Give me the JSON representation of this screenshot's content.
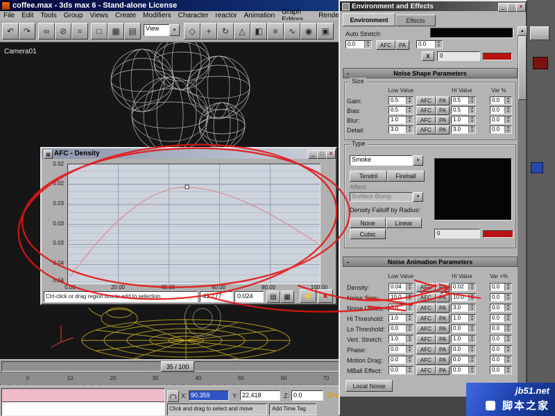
{
  "icons": {
    "min": "_",
    "max": "□",
    "close": "×",
    "up": "▲",
    "down": "▼",
    "minus": "-",
    "afc_window": "▦",
    "lightning": "⚡",
    "grid": "▤",
    "cells": "▦",
    "dropdown": "▼"
  },
  "main": {
    "title": "coffee.max - 3ds max 6 - Stand-alone License",
    "menus": [
      "File",
      "Edit",
      "Tools",
      "Group",
      "Views",
      "Create",
      "Modifiers",
      "Character",
      "reactor",
      "Animation",
      "Graph Editors",
      "Render"
    ],
    "toolbar": {
      "view_combo": "View",
      "icons": [
        {
          "name": "undo",
          "g": "↶"
        },
        {
          "name": "redo",
          "g": "↷"
        },
        {
          "name": "select-and-link",
          "g": "∞"
        },
        {
          "name": "unlink-selection",
          "g": "⊘"
        },
        {
          "name": "bind-to-spacewarp",
          "g": "≈"
        },
        {
          "name": "select-object",
          "g": "□"
        },
        {
          "name": "selection-region",
          "g": "▦"
        },
        {
          "name": "select-by-name",
          "g": "▤"
        },
        {
          "name": "crossing-selection",
          "g": "◇"
        },
        {
          "name": "select-and-move",
          "g": "+"
        },
        {
          "name": "select-and-rotate",
          "g": "↻"
        },
        {
          "name": "select-and-scale",
          "g": "△"
        },
        {
          "name": "mirror",
          "g": "◧"
        },
        {
          "name": "align",
          "g": "≡"
        },
        {
          "name": "curve-editor",
          "g": "∿"
        },
        {
          "name": "material-editor",
          "g": "◉"
        },
        {
          "name": "render-scene",
          "g": "▣"
        }
      ]
    },
    "viewport_label": "Camera01",
    "timeline": {
      "slider_label": "35 / 100",
      "ruler_ticks": [
        "0",
        "10",
        "20",
        "30",
        "40",
        "50",
        "60",
        "70"
      ]
    },
    "status": {
      "prompt": "Click and drag to select and move",
      "time_tag": "Add Time Tag",
      "x_label": "X:",
      "y_label": "Y:",
      "z_label": "Z:",
      "x_value": "90.359",
      "y_value": "22.418",
      "z_value": "0.0"
    }
  },
  "afc": {
    "title": "AFC - Density",
    "y_ticks": [
      "0.02",
      "0.02",
      "0.03",
      "0.03",
      "0.03",
      "0.04",
      "0.04"
    ],
    "x_ticks": [
      "0.00",
      "20.00",
      "40.00",
      "60.00",
      "80.00",
      "100.00"
    ],
    "status_text": "Ctrl-click or drag region box to add to selection.",
    "sel_x": "43.777",
    "sel_y": "0.024",
    "curve": {
      "frames": [
        0,
        20,
        43.777,
        60,
        80,
        100
      ],
      "density": [
        0.04,
        0.028,
        0.024,
        0.026,
        0.03,
        0.034
      ]
    }
  },
  "env": {
    "title": "Environment and Effects",
    "tabs": [
      "Environment",
      "Effects"
    ],
    "afc_label": "AFC",
    "pa_label": "PA",
    "auto_stretch": {
      "label": "Auto Stretch:",
      "low": "0.0",
      "hi": "0.0",
      "x_btn": "X",
      "x_val": "0"
    },
    "shape": {
      "header": "Noise Shape Parameters",
      "group": "Size",
      "col_low": "Low Value",
      "col_hi": "Hi Value",
      "col_var": "Var %",
      "rows": [
        {
          "label": "Gain:",
          "low": "0.5",
          "hi": "0.5",
          "var": "0.0"
        },
        {
          "label": "Bias:",
          "low": "0.5",
          "hi": "0.5",
          "var": "0.0"
        },
        {
          "label": "Blur:",
          "low": "1.0",
          "hi": "1.0",
          "var": "0.0"
        },
        {
          "label": "Detail:",
          "low": "3.0",
          "hi": "3.0",
          "var": "0.0"
        }
      ]
    },
    "type": {
      "label": "Type",
      "selected": "Smoke",
      "tendril": "Tendril",
      "fireball": "Fireball",
      "affect_label": "Affect:",
      "affect_selected": "Surface Bump",
      "falloff_label": "Density Falloff by Radius:",
      "none": "None",
      "linear": "Linear",
      "cubic": "Cubic",
      "value": "0"
    },
    "anim": {
      "header": "Noise Animation Parameters",
      "col_low": "Low Value",
      "col_hi": "Hi Value",
      "col_var": "Var +%",
      "rows": [
        {
          "label": "Density:",
          "low": "0.04",
          "hi": "0.02",
          "var": "0.0"
        },
        {
          "label": "Noise Size:",
          "low": "10.0",
          "hi": "10.0",
          "var": "0.0"
        },
        {
          "label": "Noise Levels:",
          "low": "3.0",
          "hi": "3.0",
          "var": "0.0"
        },
        {
          "label": "Hi Threshold:",
          "low": "1.0",
          "hi": "1.0",
          "var": "0.0"
        },
        {
          "label": "Lo Threshold:",
          "low": "0.0",
          "hi": "0.0",
          "var": "0.0"
        },
        {
          "label": "Vert. Stretch:",
          "low": "1.0",
          "hi": "1.0",
          "var": "0.0"
        },
        {
          "label": "Phase:",
          "low": "0.0",
          "hi": "0.0",
          "var": "0.0"
        },
        {
          "label": "Motion Drag:",
          "low": "0.0",
          "hi": "0.0",
          "var": "0.0"
        },
        {
          "label": "MBall Effect:",
          "low": "0.0",
          "hi": "0.0",
          "var": "0.0"
        }
      ],
      "local_noise": "Local Noise"
    }
  },
  "watermark": {
    "line1": "jb51.net",
    "line2": "脚本之家"
  },
  "colors": {
    "annotation": "#e41414",
    "swatch_red": "#b81212",
    "titlebar_blue": "#10307c"
  }
}
